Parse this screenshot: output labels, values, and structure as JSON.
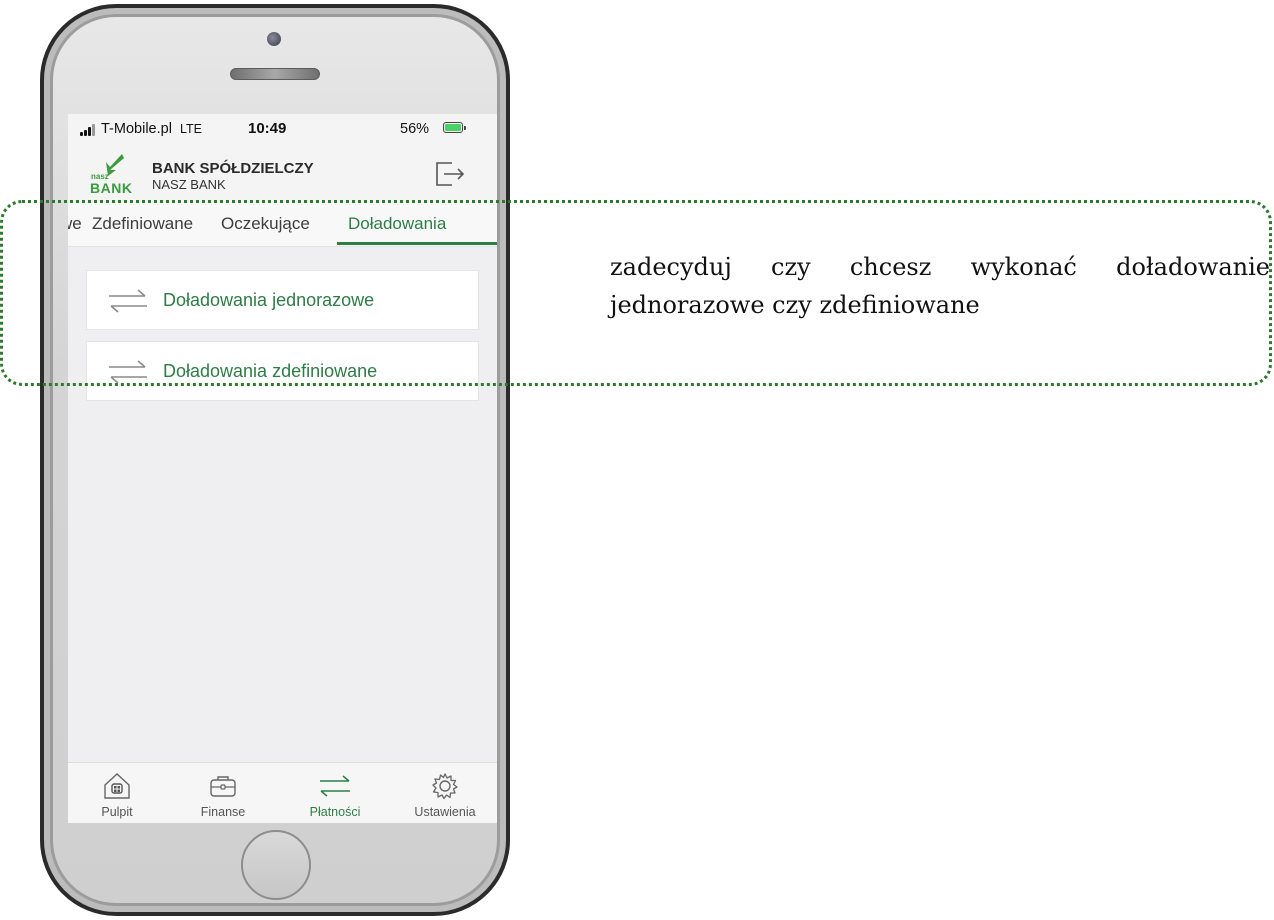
{
  "status_bar": {
    "carrier": "T-Mobile.pl",
    "network": "LTE",
    "time": "10:49",
    "battery": "56%"
  },
  "header": {
    "logo_small": "nasz",
    "logo_big": "BANK",
    "bank_name": "BANK SPÓŁDZIELCZY",
    "bank_subname": "NASZ BANK"
  },
  "tabs": [
    {
      "label": "we",
      "active": false
    },
    {
      "label": "Zdefiniowane",
      "active": false
    },
    {
      "label": "Oczekujące",
      "active": false
    },
    {
      "label": "Doładowania",
      "active": true
    }
  ],
  "options": [
    {
      "label": "Doładowania jednorazowe",
      "icon": "swap-arrows-icon"
    },
    {
      "label": "Doładowania zdefiniowane",
      "icon": "swap-arrows-icon"
    }
  ],
  "bottom_nav": [
    {
      "label": "Pulpit",
      "icon": "home-icon",
      "active": false
    },
    {
      "label": "Finanse",
      "icon": "wallet-icon",
      "active": false
    },
    {
      "label": "Płatności",
      "icon": "swap-arrows-icon",
      "active": true
    },
    {
      "label": "Ustawienia",
      "icon": "gear-icon",
      "active": false
    }
  ],
  "instruction": "zadecyduj czy chcesz wykonać doładowanie jednorazowe czy zdefiniowane",
  "colors": {
    "accent": "#2e7d46",
    "callout_border": "#2d7a2d",
    "brand_green": "#3a9b3f"
  }
}
